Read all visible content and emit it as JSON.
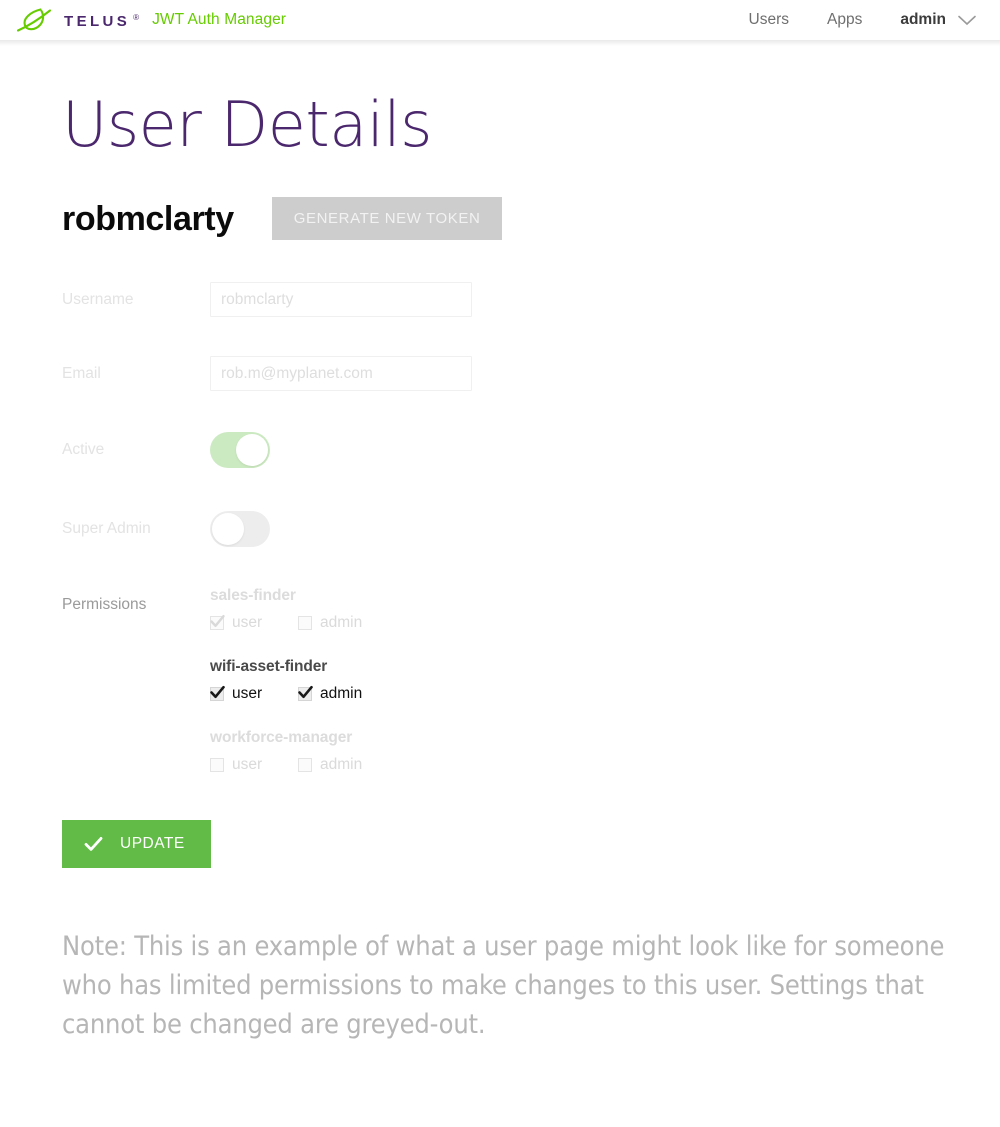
{
  "colors": {
    "telus_purple": "#4B286D",
    "telus_green": "#66CC00",
    "update_green": "#62BB46",
    "toggle_on": "#cceac2",
    "toggle_off": "#ededed",
    "disabled_button": "#cdcdcd",
    "disabled_text": "#e3e3e3",
    "note_text": "#b6b6b6"
  },
  "topbar": {
    "logo_word": "TELUS",
    "logo_reg": "®",
    "app_title": "JWT Auth Manager",
    "nav": [
      {
        "label": "Users"
      },
      {
        "label": "Apps"
      }
    ],
    "user": {
      "name": "admin",
      "chevron": "chevron-down-icon"
    }
  },
  "page": {
    "title": "User Details",
    "username_heading": "robmclarty",
    "generate_token_label": "GENERATE NEW TOKEN"
  },
  "form": {
    "fields": [
      {
        "label": "Username",
        "value": "robmclarty",
        "disabled": true
      },
      {
        "label": "Email",
        "value": "rob.m@myplanet.com",
        "disabled": true
      }
    ],
    "toggles": [
      {
        "label": "Active",
        "on": true,
        "disabled": true
      },
      {
        "label": "Super Admin",
        "on": false,
        "disabled": true
      }
    ],
    "permissions_label": "Permissions",
    "permissions": [
      {
        "app": "sales-finder",
        "disabled": true,
        "roles": [
          {
            "label": "user",
            "checked": true
          },
          {
            "label": "admin",
            "checked": false
          }
        ]
      },
      {
        "app": "wifi-asset-finder",
        "disabled": false,
        "roles": [
          {
            "label": "user",
            "checked": true
          },
          {
            "label": "admin",
            "checked": true
          }
        ]
      },
      {
        "app": "workforce-manager",
        "disabled": true,
        "roles": [
          {
            "label": "user",
            "checked": false
          },
          {
            "label": "admin",
            "checked": false
          }
        ]
      }
    ],
    "update_label": "UPDATE",
    "update_icon": "checkmark-icon"
  },
  "note": "Note: This is an example of what a user page might look like for someone who has limited permissions to make changes to this user. Settings that cannot be changed are greyed-out."
}
